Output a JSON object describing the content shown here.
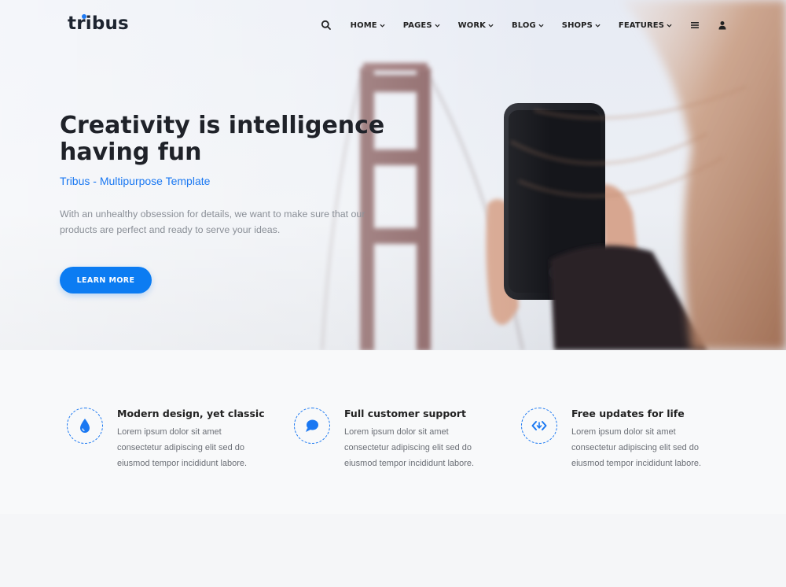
{
  "brand": {
    "name": "tribus",
    "accent": "#1a78f2"
  },
  "nav": {
    "search_icon": "search-icon",
    "items": [
      {
        "label": "HOME"
      },
      {
        "label": "PAGES"
      },
      {
        "label": "WORK"
      },
      {
        "label": "BLOG"
      },
      {
        "label": "SHOPS"
      },
      {
        "label": "FEATURES"
      }
    ],
    "menu_icon": "hamburger-icon",
    "user_icon": "user-icon"
  },
  "hero": {
    "title_line1": "Creativity is intelligence",
    "title_line2": "having fun",
    "subtitle": "Tribus - Multipurpose Template",
    "description": "With an unhealthy obsession for details, we want to make sure that our products are perfect and ready to serve your ideas.",
    "button_label": "LEARN MORE"
  },
  "features": [
    {
      "icon": "water-drop-icon",
      "title": "Modern design, yet classic",
      "text": "Lorem ipsum dolor sit amet consectetur adipiscing elit sed do eiusmod tempor incididunt labore."
    },
    {
      "icon": "chat-bubble-icon",
      "title": "Full customer support",
      "text": "Lorem ipsum dolor sit amet consectetur adipiscing elit sed do eiusmod tempor incididunt labore."
    },
    {
      "icon": "code-icon",
      "title": "Free updates for life",
      "text": "Lorem ipsum dolor sit amet consectetur adipiscing elit sed do eiusmod tempor incididunt labore."
    }
  ]
}
